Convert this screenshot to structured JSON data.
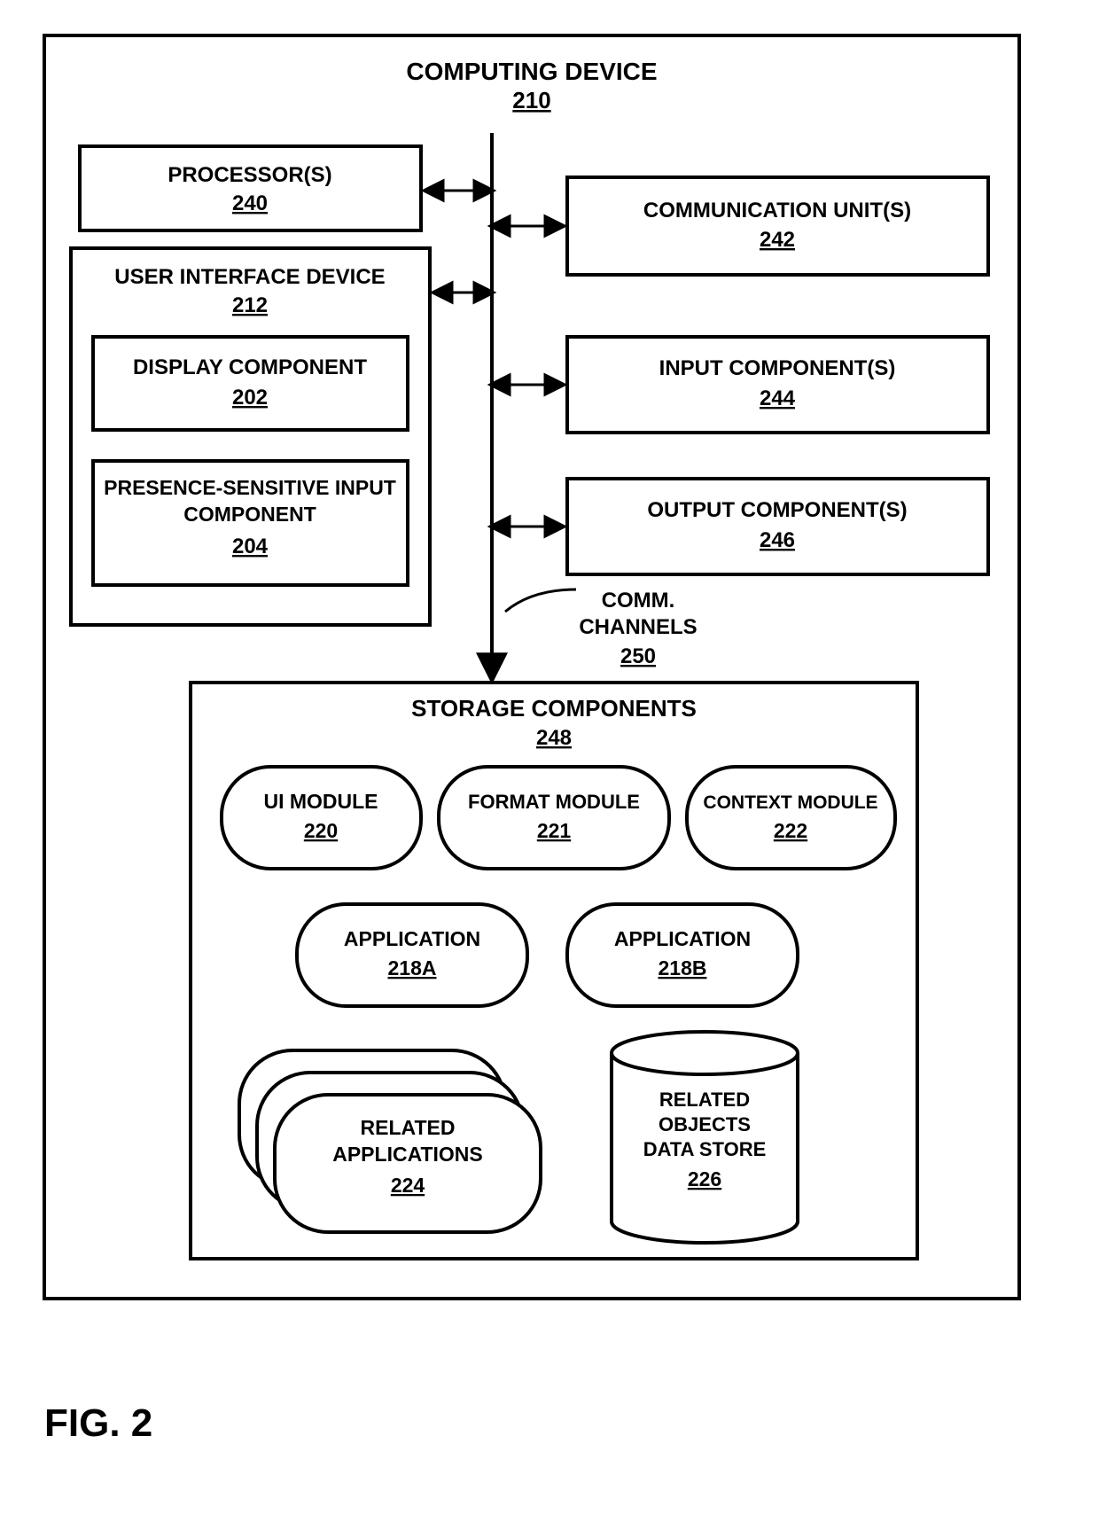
{
  "figure": {
    "caption": "FIG. 2"
  },
  "device": {
    "title": "COMPUTING DEVICE",
    "ref": "210"
  },
  "processor": {
    "title": "PROCESSOR(S)",
    "ref": "240"
  },
  "uid": {
    "title": "USER INTERFACE DEVICE",
    "ref": "212"
  },
  "display": {
    "title": "DISPLAY COMPONENT",
    "ref": "202"
  },
  "psinput": {
    "title1": "PRESENCE-SENSITIVE INPUT",
    "title2": "COMPONENT",
    "ref": "204"
  },
  "commUnits": {
    "title": "COMMUNICATION UNIT(S)",
    "ref": "242"
  },
  "inputComp": {
    "title": "INPUT COMPONENT(S)",
    "ref": "244"
  },
  "outputComp": {
    "title": "OUTPUT COMPONENT(S)",
    "ref": "246"
  },
  "commChannels": {
    "title1": "COMM.",
    "title2": "CHANNELS",
    "ref": "250"
  },
  "storage": {
    "title": "STORAGE COMPONENTS",
    "ref": "248"
  },
  "uiModule": {
    "title": "UI MODULE",
    "ref": "220"
  },
  "formatModule": {
    "title": "FORMAT MODULE",
    "ref": "221"
  },
  "contextModule": {
    "title": "CONTEXT MODULE",
    "ref": "222"
  },
  "appA": {
    "title": "APPLICATION",
    "ref": "218A"
  },
  "appB": {
    "title": "APPLICATION",
    "ref": "218B"
  },
  "relatedApps": {
    "title1": "RELATED",
    "title2": "APPLICATIONS",
    "ref": "224"
  },
  "dataStore": {
    "title1": "RELATED",
    "title2": "OBJECTS",
    "title3": "DATA STORE",
    "ref": "226"
  }
}
